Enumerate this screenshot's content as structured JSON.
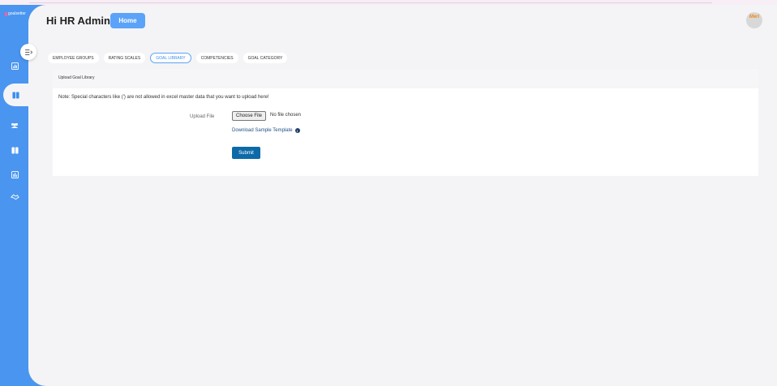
{
  "brand": {
    "name": "goalsetter"
  },
  "header": {
    "greeting": "Hi HR Admin",
    "home_label": "Home",
    "avatar_text": "Meri"
  },
  "sidebar": {
    "items": [
      {
        "icon": "chart-icon"
      },
      {
        "icon": "book-icon",
        "active": true
      },
      {
        "icon": "users-icon"
      },
      {
        "icon": "library-icon"
      },
      {
        "icon": "report-icon"
      },
      {
        "icon": "handshake-icon"
      }
    ]
  },
  "tabs": [
    {
      "label": "EMPLOYEE GROUPS"
    },
    {
      "label": "RATING SCALES"
    },
    {
      "label": "GOAL LIBRARY",
      "active": true
    },
    {
      "label": "COMPETENCIES"
    },
    {
      "label": "GOAL CATEGORY"
    }
  ],
  "card": {
    "title": "Upload Goal Library",
    "note": "Note: Special characters like (') are not allowed in excel master data that you want to upload here!",
    "upload_label": "Upload File",
    "choose_file_label": "Choose File",
    "no_file_text": "No file chosen",
    "download_label": "Download Sample Template",
    "submit_label": "Submit"
  },
  "colors": {
    "sidebar": "#4a95f0",
    "accent": "#5ba3f8",
    "submit": "#0d6aa8"
  }
}
